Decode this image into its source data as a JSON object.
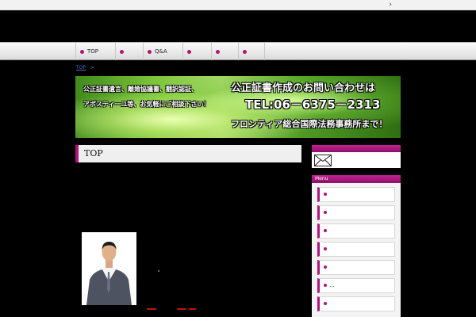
{
  "topbar": {
    "arrow": "›"
  },
  "nav": {
    "items": [
      {
        "label": "TOP"
      },
      {
        "label": ""
      },
      {
        "label": "Q&A"
      },
      {
        "label": ""
      },
      {
        "label": ""
      },
      {
        "label": ""
      }
    ]
  },
  "breadcrumb": {
    "home": "TOP",
    "sep": ">"
  },
  "banner": {
    "line1": "公正証書遺言、離婚協議書、翻訳認証、",
    "line2": "アポスティーユ等、お気軽にご相談下さい！",
    "headline": "公正証書作成のお問い合わせは",
    "tel": "TEL:06－6375－2313",
    "office": "フロンティア総合国際法務事務所まで！"
  },
  "page": {
    "title": "TOP"
  },
  "sidebar": {
    "menu_title": "Menu",
    "items": [
      {
        "label": ""
      },
      {
        "label": ""
      },
      {
        "label": ""
      },
      {
        "label": ""
      },
      {
        "label": ""
      },
      {
        "label": "..."
      },
      {
        "label": ""
      }
    ]
  },
  "colors": {
    "accent": "#b0137a",
    "background": "#000000",
    "nav": "#e6e6e6"
  },
  "icons": [
    "mail-icon",
    "bullet-icon",
    "chevron-right-icon"
  ]
}
